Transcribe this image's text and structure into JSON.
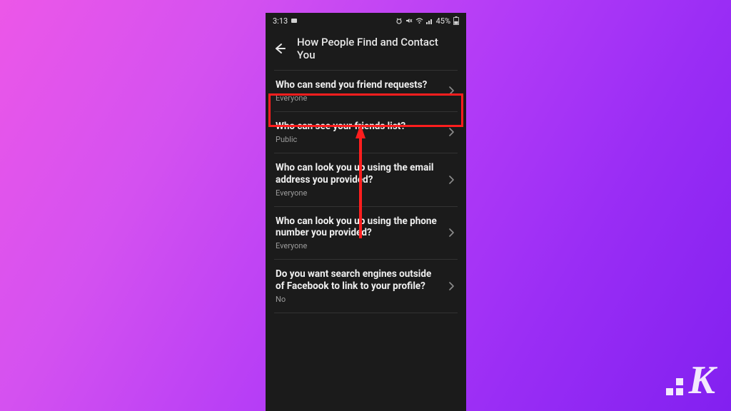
{
  "statusbar": {
    "time": "3:13",
    "battery": "45%",
    "icons": {
      "card": "card-icon",
      "alarm": "alarm-icon",
      "mute": "mute-icon",
      "wifi": "wifi-icon",
      "signal": "signal-icon",
      "batt": "battery-icon"
    }
  },
  "header": {
    "title": "How People Find and Contact You"
  },
  "settings": [
    {
      "label": "Who can send you friend requests?",
      "value": "Everyone",
      "name": "setting-friend-requests"
    },
    {
      "label": "Who can see your friends list?",
      "value": "Public",
      "name": "setting-friends-list",
      "highlighted": true
    },
    {
      "label": "Who can look you up using the email address you provided?",
      "value": "Everyone",
      "name": "setting-lookup-email"
    },
    {
      "label": "Who can look you up using the phone number you provided?",
      "value": "Everyone",
      "name": "setting-lookup-phone"
    },
    {
      "label": "Do you want search engines outside of Facebook to link to your profile?",
      "value": "No",
      "name": "setting-search-engines"
    }
  ],
  "annotation": {
    "highlight_border_color": "#ff1e1e",
    "arrow_color": "#ff1e1e"
  },
  "brand": {
    "letter": "K"
  }
}
